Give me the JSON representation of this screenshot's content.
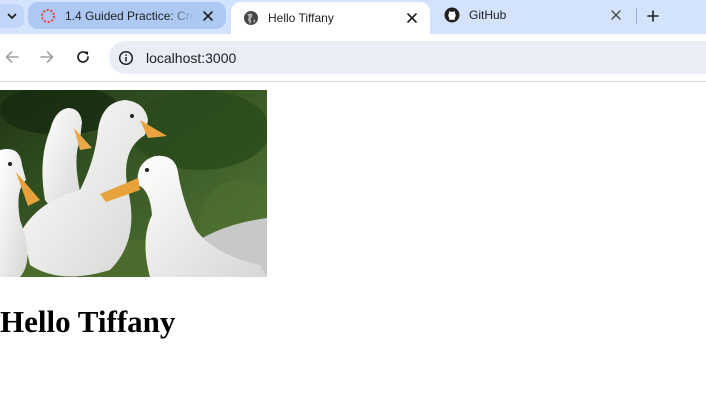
{
  "browser": {
    "tabs": [
      {
        "title": "1.4 Guided Practice: Crea",
        "active": false
      },
      {
        "title": "Hello Tiffany",
        "active": true
      },
      {
        "title": "GitHub",
        "active": false
      }
    ],
    "address": "localhost:3000"
  },
  "page": {
    "heading": "Hello Tiffany",
    "image": "white-ducks-photo"
  },
  "colors": {
    "tabstrip": "#d3e3fd",
    "omnibox": "#e9eef6",
    "tab_loading_ring": "#e5484d"
  }
}
